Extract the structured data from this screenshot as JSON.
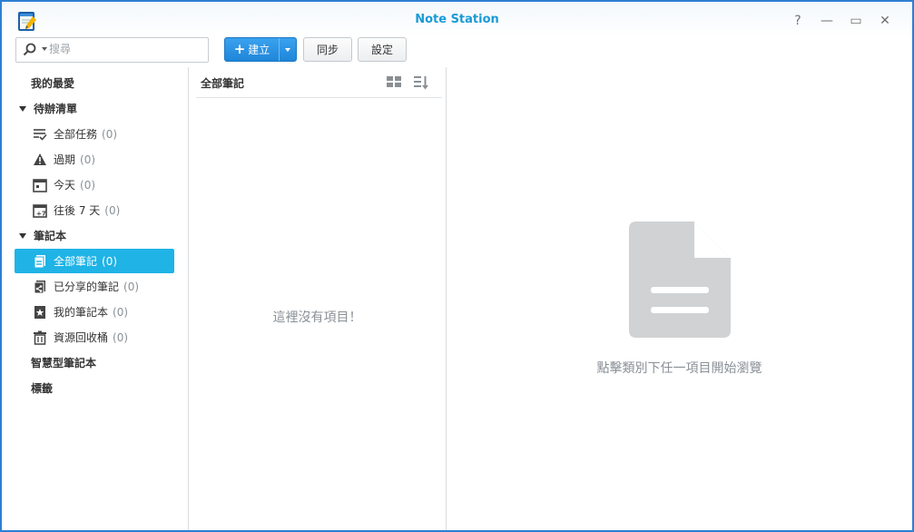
{
  "window": {
    "title": "Note Station",
    "controls": {
      "help": "?",
      "minimize": "—",
      "maximize": "▭",
      "close": "✕"
    }
  },
  "toolbar": {
    "search_placeholder": "搜尋",
    "create_label": "建立",
    "sync_label": "同步",
    "settings_label": "設定"
  },
  "sidebar": {
    "favorites": "我的最愛",
    "todo_group": "待辦清單",
    "todo_items": [
      {
        "label": "全部任務",
        "count": "(0)",
        "icon": "checklist-icon"
      },
      {
        "label": "過期",
        "count": "(0)",
        "icon": "warning-icon"
      },
      {
        "label": "今天",
        "count": "(0)",
        "icon": "calendar-today-icon"
      },
      {
        "label": "往後 7 天",
        "count": "(0)",
        "icon": "calendar-week-icon"
      }
    ],
    "notebook_group": "筆記本",
    "notebook_items": [
      {
        "label": "全部筆記",
        "count": "(0)",
        "icon": "notes-icon",
        "active": true
      },
      {
        "label": "已分享的筆記",
        "count": "(0)",
        "icon": "shared-notes-icon"
      },
      {
        "label": "我的筆記本",
        "count": "(0)",
        "icon": "notebook-star-icon"
      },
      {
        "label": "資源回收桶",
        "count": "(0)",
        "icon": "trash-icon"
      }
    ],
    "smart_notebook": "智慧型筆記本",
    "tags": "標籤"
  },
  "list": {
    "title": "全部筆記",
    "empty": "這裡沒有項目！"
  },
  "preview": {
    "hint": "點擊類別下任一項目開始瀏覽"
  },
  "colors": {
    "accent": "#1fb3e6",
    "title": "#1a9ad6",
    "primary_button": "#2a93e3",
    "frame": "#2d7fd3"
  }
}
